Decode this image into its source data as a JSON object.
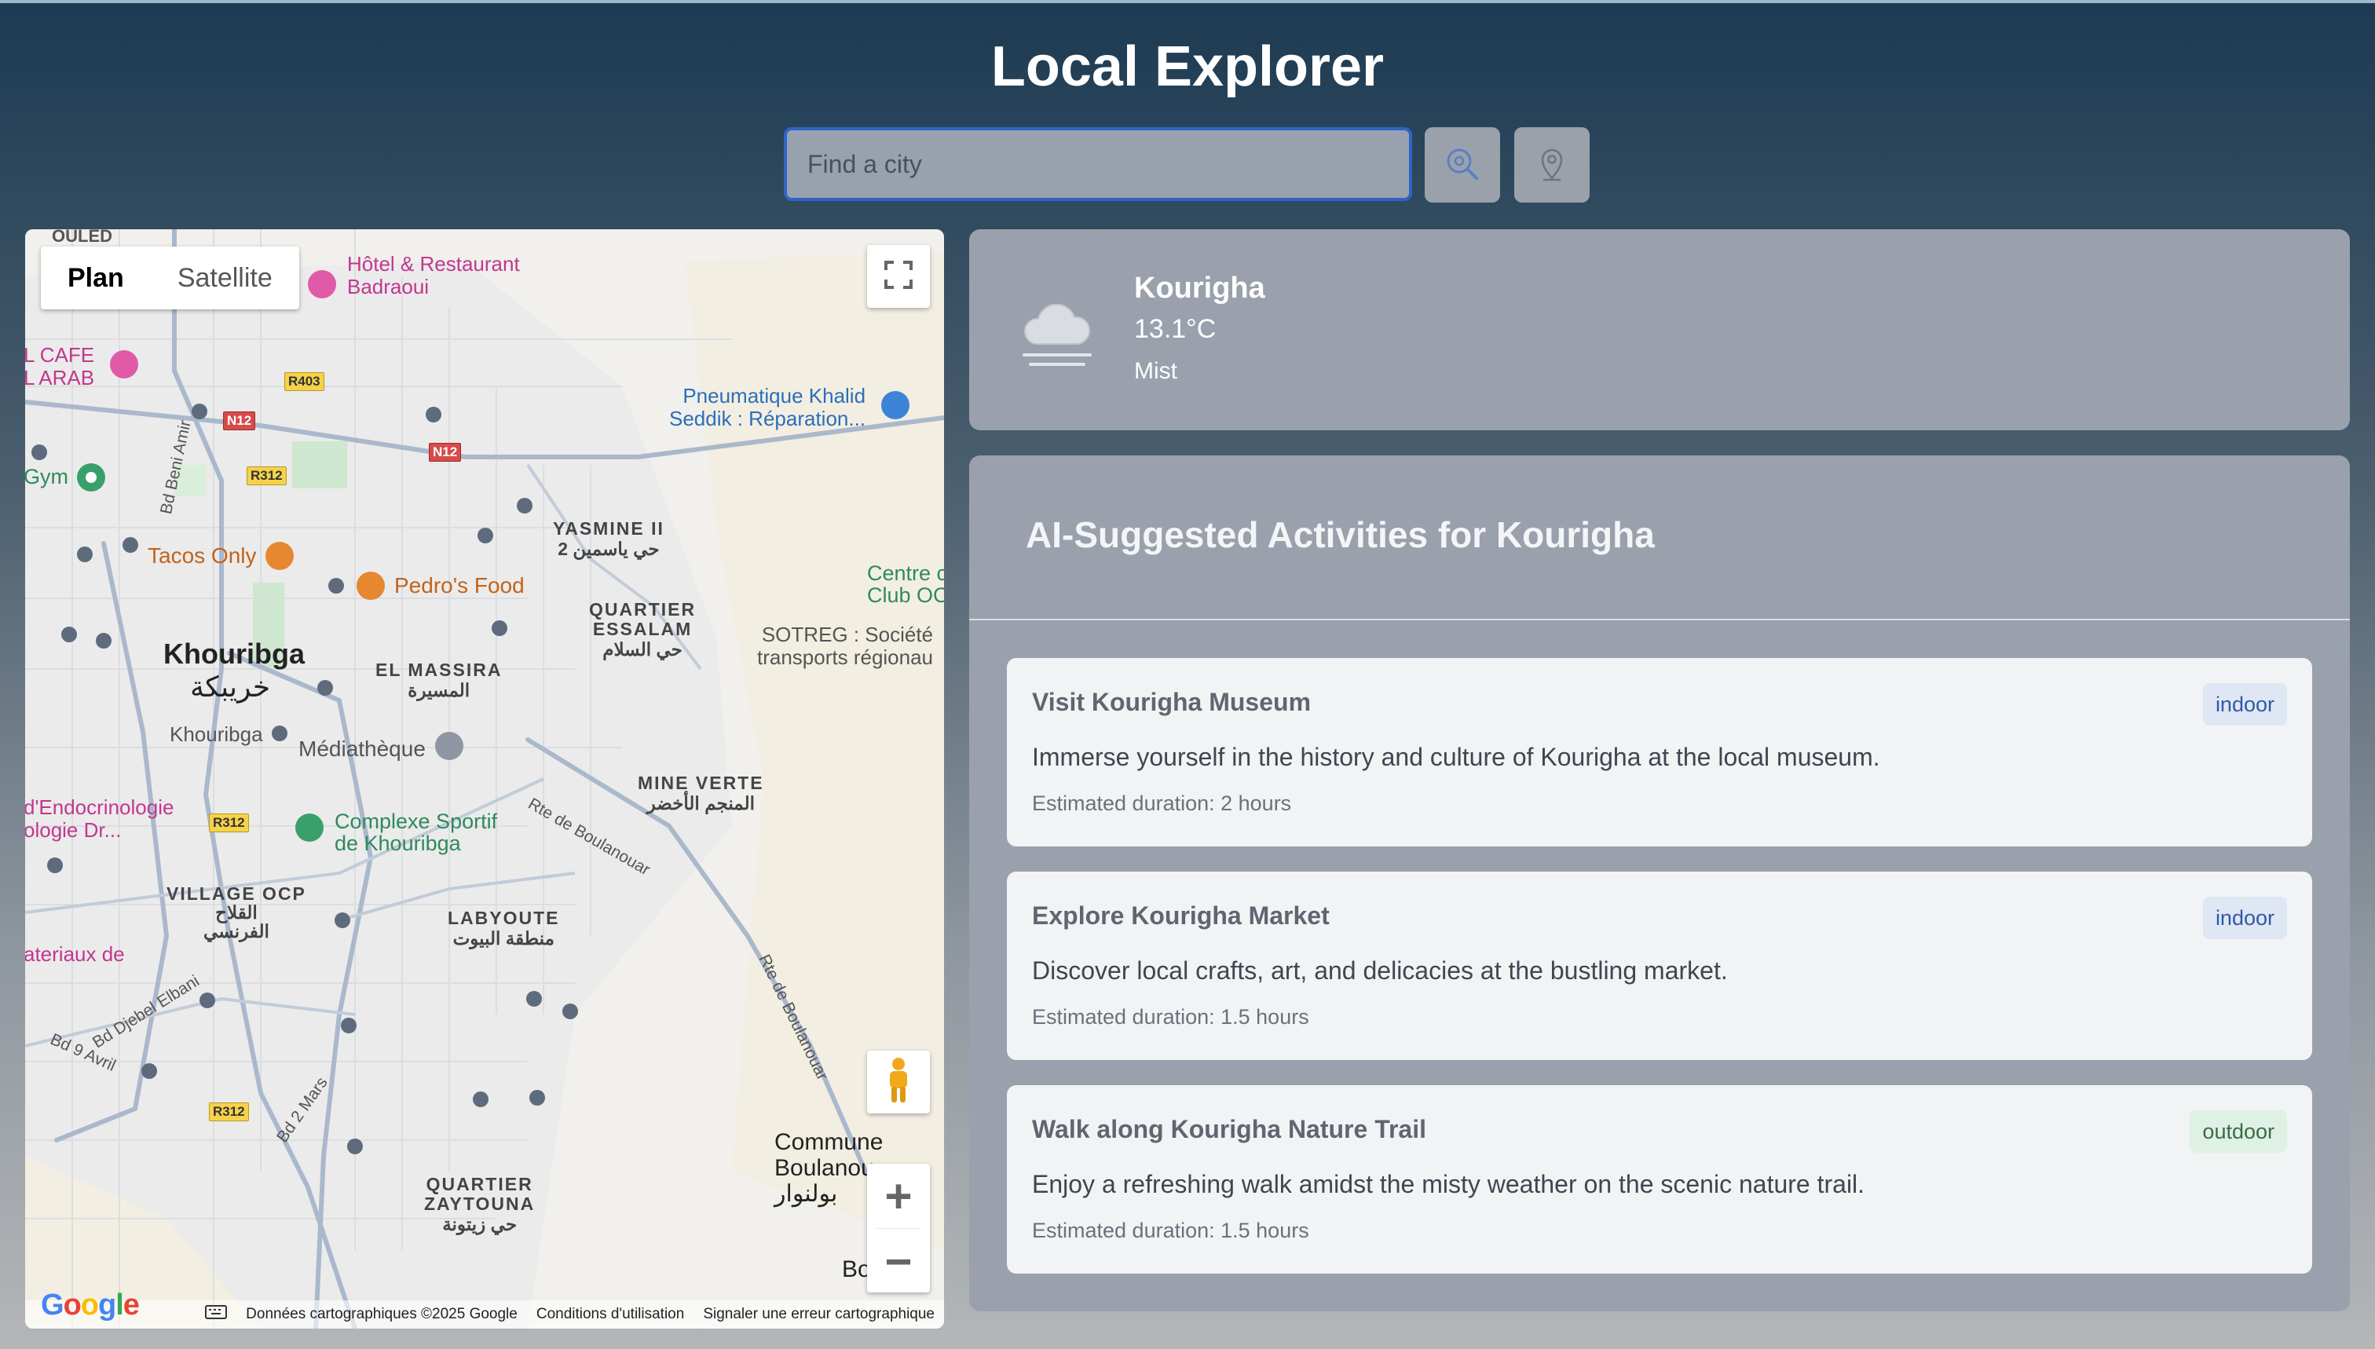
{
  "app": {
    "title": "Local Explorer"
  },
  "search": {
    "placeholder": "Find a city",
    "value": ""
  },
  "icons": {
    "search_button": "search-location-icon",
    "locate_button": "location-pin-icon",
    "weather": "cloud-mist-icon"
  },
  "map": {
    "types": [
      "Plan",
      "Satellite"
    ],
    "active_type": "Plan",
    "labels": {
      "ouled": "OULED",
      "hotel": "Hôtel & Restaurant\nBadraoui",
      "cafe": "L CAFE\nL ARAB",
      "pneumatique": "Pneumatique Khalid\nSeddik : Réparation...",
      "gym": "Gym",
      "tacos": "Tacos Only",
      "pedros": "Pedro's Food",
      "yasmine": "YASMINE II\nحي ياسمين 2",
      "quartier_essalam": "QUARTIER\nESSALAM\nحي السلام",
      "centre": "Centre c\nClub OC",
      "sotreg": "SOTREG : Société\ntransports régionau",
      "khouribga": "Khouribga",
      "khouribga_ar": "خريبكة",
      "el_massira": "EL MASSIRA\nالمسيرة",
      "khouribga_station": "Khouribga",
      "mediatheque": "Médiathèque",
      "mine_verte": "MINE VERTE\nالمنجم الأخضر",
      "endocrinologie": "d'Endocrinologie\nologie Dr...",
      "complexe": "Complexe Sportif\nde Khouribga",
      "village_ocp": "VILLAGE OCP\nالقلاح\nالفرنسي",
      "labyoute": "LABYOUTE\nمنطقة البيوت",
      "materiaux": "ateriaux de",
      "commune": "Commune\nBoulanou\nبولنوار",
      "quartier_zaytouna": "QUARTIER\nZAYTOUNA\nحي زيتونة",
      "bo": "Bo",
      "rte_boulanouar_1": "Rte de Boulanouar",
      "rte_boulanouar_2": "Rte de Boulanouar",
      "bd_beni_amir": "Bd Beni Amir",
      "bd_djebel": "Bd Djebel Elbani",
      "bd_9_avril": "Bd 9 Avril",
      "bd_2_mars": "Bd 2 Mars"
    },
    "shields": [
      "R403",
      "N12",
      "N12",
      "R312",
      "R312",
      "R312"
    ],
    "google": "Google",
    "attribution": {
      "data": "Données cartographiques ©2025 Google",
      "terms": "Conditions d'utilisation",
      "report": "Signaler une erreur cartographique"
    }
  },
  "weather": {
    "city": "Kourigha",
    "temperature": "13.1°C",
    "condition": "Mist"
  },
  "activities": {
    "heading": "AI-Suggested Activities for Kourigha",
    "items": [
      {
        "title": "Visit Kourigha Museum",
        "description": "Immerse yourself in the history and culture of Kourigha at the local museum.",
        "duration": "Estimated duration: 2 hours",
        "tag": "indoor"
      },
      {
        "title": "Explore Kourigha Market",
        "description": "Discover local crafts, art, and delicacies at the bustling market.",
        "duration": "Estimated duration: 1.5 hours",
        "tag": "indoor"
      },
      {
        "title": "Walk along Kourigha Nature Trail",
        "description": "Enjoy a refreshing walk amidst the misty weather on the scenic nature trail.",
        "duration": "Estimated duration: 1.5 hours",
        "tag": "outdoor"
      }
    ]
  },
  "colors": {
    "search_border": "#2f63c9",
    "card_bg": "#9aa0ac",
    "indoor_badge": "#dfe6f4",
    "outdoor_badge": "#dff0e4"
  }
}
